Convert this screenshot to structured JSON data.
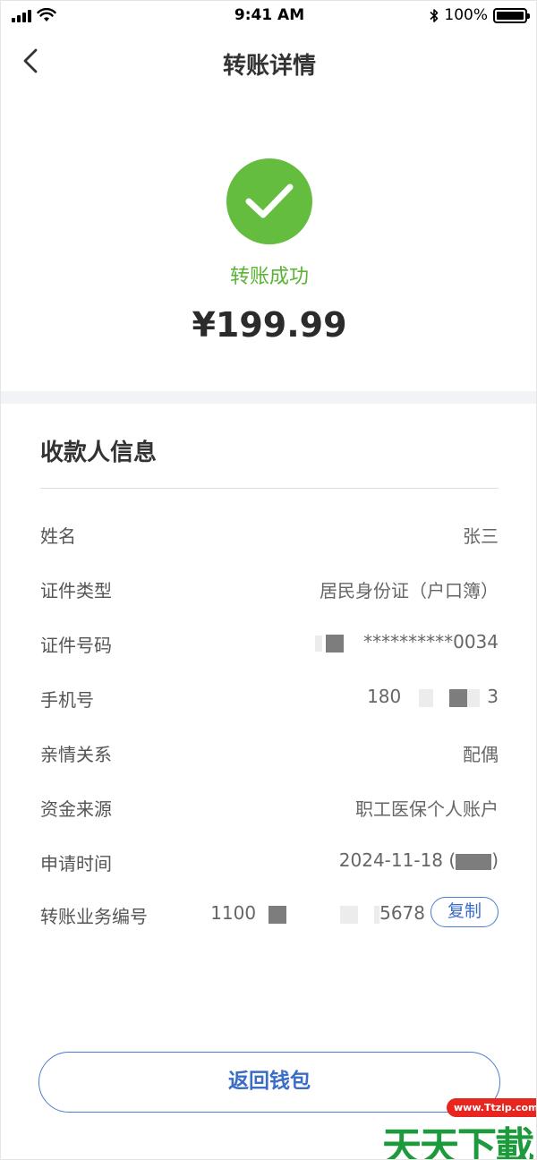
{
  "status_bar": {
    "time": "9:41 AM",
    "battery": "100%"
  },
  "nav": {
    "title": "转账详情"
  },
  "hero": {
    "status_text": "转账成功",
    "amount": "¥199.99",
    "success_color": "#64bd3f"
  },
  "payee": {
    "section_title": "收款人信息",
    "rows": [
      {
        "label": "姓名",
        "value": "张三"
      },
      {
        "label": "证件类型",
        "value": "居民身份证（户口簿）"
      },
      {
        "label": "证件号码",
        "value_prefix": "",
        "value_suffix": "**********0034"
      },
      {
        "label": "手机号",
        "value_prefix": "180",
        "value_suffix": "3"
      },
      {
        "label": "亲情关系",
        "value": "配偶"
      },
      {
        "label": "资金来源",
        "value": "职工医保个人账户"
      },
      {
        "label": "申请时间",
        "value_prefix": "2024-11-18",
        "value_suffix": ""
      },
      {
        "label": "转账业务编号",
        "value_prefix": "1100",
        "value_suffix": "5678",
        "copy_label": "复制"
      }
    ]
  },
  "footer": {
    "return_label": "返回钱包"
  },
  "watermark": {
    "url": "www.Ttzip.com",
    "text": "天天下載"
  },
  "colors": {
    "accent": "#3a6cc8",
    "success": "#5ab334"
  },
  "icons": {
    "back": "chevron-left-icon",
    "success": "checkmark-icon",
    "bluetooth": "bluetooth-icon",
    "wifi": "wifi-icon",
    "signal": "signal-icon",
    "battery": "battery-icon"
  }
}
